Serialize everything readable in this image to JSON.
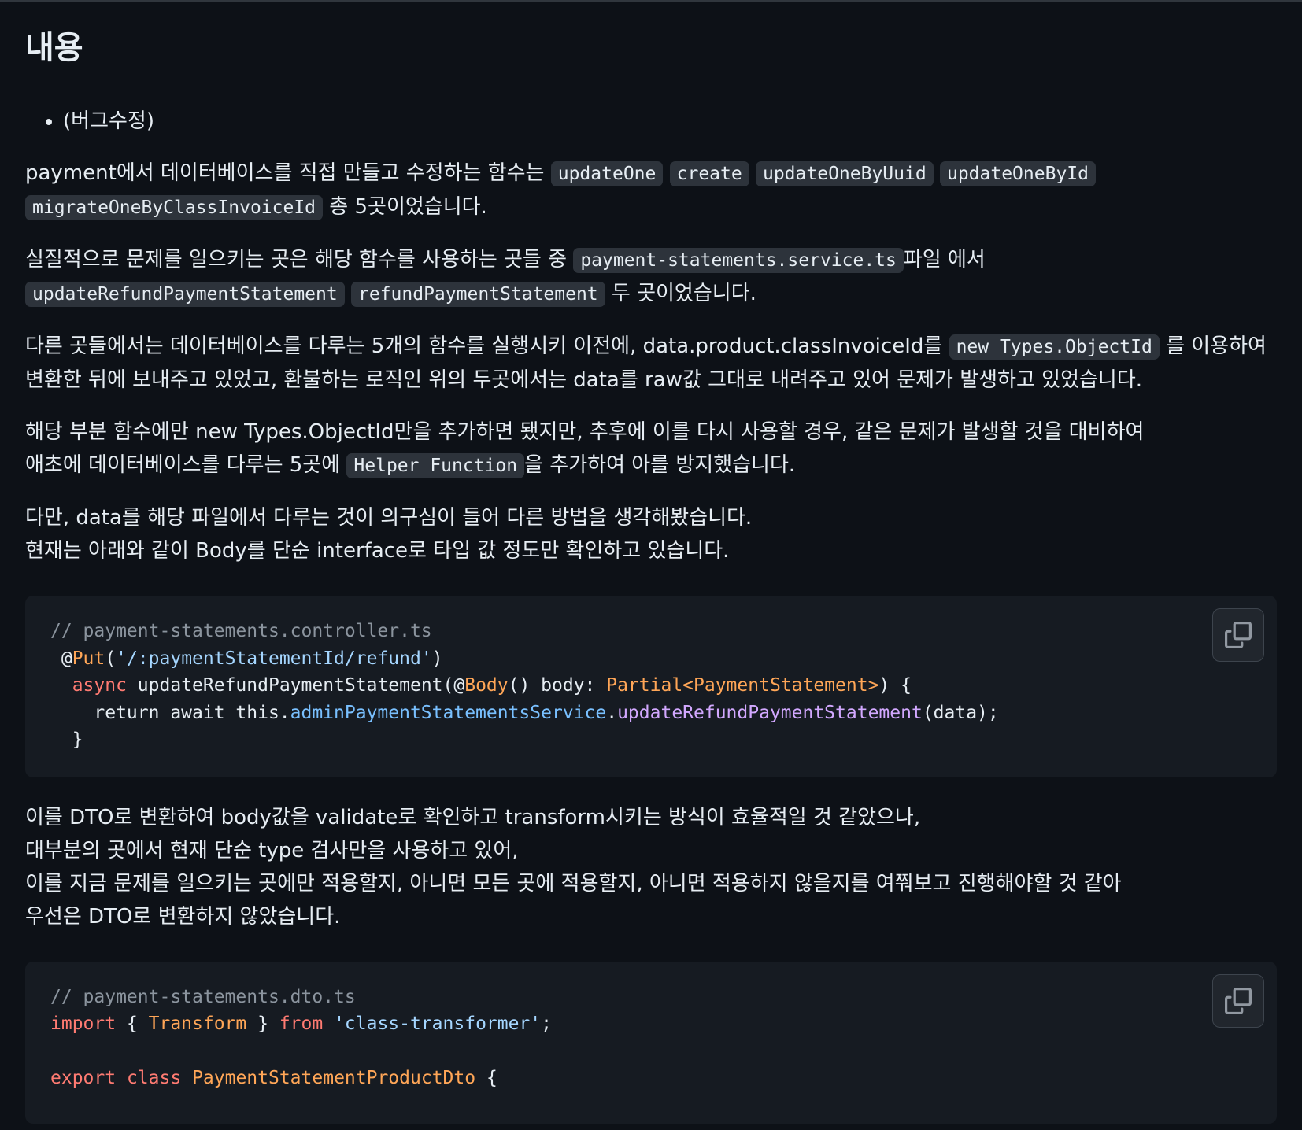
{
  "heading": "내용",
  "bullets": [
    "(버그수정)"
  ],
  "p1": {
    "t1": "payment에서 데이터베이스를 직접 만들고 수정하는 함수는 ",
    "codes": [
      "updateOne",
      "create",
      "updateOneByUuid",
      "updateOneById",
      "migrateOneByClassInvoiceId"
    ],
    "t2": " 총 5곳이었습니다."
  },
  "p2": {
    "t1": "실질적으로 문제를 일으키는 곳은 해당 함수를 사용하는 곳들 중 ",
    "c1": "payment-statements.service.ts",
    "t2": "파일 에서",
    "c2": "updateRefundPaymentStatement",
    "c3": "refundPaymentStatement",
    "t3": " 두 곳이었습니다."
  },
  "p3": {
    "t1": "다른 곳들에서는 데이터베이스를 다루는 5개의 함수를 실행시키 이전에, data.product.classInvoiceId를 ",
    "c1": "new Types.ObjectId",
    "t2": " 를 이용하여 변환한 뒤에 보내주고 있었고, 환불하는 로직인 위의 두곳에서는 data를 raw값 그대로 내려주고 있어 문제가 발생하고 있었습니다."
  },
  "p4": {
    "line1": "해당 부분 함수에만 new Types.ObjectId만을 추가하면 됐지만, 추후에 이를 다시 사용할 경우, 같은 문제가 발생할 것을 대비하여",
    "t1": "애초에 데이터베이스를 다루는 5곳에 ",
    "c1": "Helper Function",
    "t2": "을 추가하여 아를 방지했습니다."
  },
  "p5": {
    "line1": "다만, data를 해당 파일에서 다루는 것이 의구심이 들어 다른 방법을 생각해봤습니다.",
    "line2": "현재는 아래와 같이 Body를 단순 interface로 타입 값 정도만 확인하고 있습니다."
  },
  "code1": {
    "comment": "// payment-statements.controller.ts",
    "l2_pre": " @",
    "l2_deco": "Put",
    "l2_open": "(",
    "l2_str": "'/:paymentStatementId/refund'",
    "l2_close": ")",
    "l3_indent": "  ",
    "l3_kw": "async",
    "l3_mid": " updateRefundPaymentStatement(@",
    "l3_deco": "Body",
    "l3_mid2": "() body: ",
    "l3_type": "Partial<PaymentStatement>",
    "l3_end": ") {",
    "l4_pre": "    return await this.",
    "l4_prop": "adminPaymentStatementsService",
    "l4_dot": ".",
    "l4_fn": "updateRefundPaymentStatement",
    "l4_end": "(data);",
    "l5": "  }"
  },
  "p6": {
    "line1": "이를 DTO로 변환하여 body값을 validate로 확인하고 transform시키는 방식이 효율적일 것 같았으나,",
    "line2": "대부분의 곳에서 현재 단순 type 검사만을 사용하고 있어,",
    "line3": "이를 지금 문제를 일으키는 곳에만 적용할지, 아니면 모든 곳에 적용할지, 아니면 적용하지 않을지를 여쭤보고 진행해야할 것 같아",
    "line4": "우선은 DTO로 변환하지 않았습니다."
  },
  "code2": {
    "comment": "// payment-statements.dto.ts",
    "l2_kw1": "import",
    "l2_mid1": " { ",
    "l2_type": "Transform",
    "l2_mid2": " } ",
    "l2_kw2": "from",
    "l2_sp": " ",
    "l2_str": "'class-transformer'",
    "l2_end": ";",
    "l4_kw1": "export",
    "l4_sp1": " ",
    "l4_kw2": "class",
    "l4_sp2": " ",
    "l4_type": "PaymentStatementProductDto",
    "l4_end": " {"
  },
  "icons": {
    "copy": "copy-icon"
  },
  "colors": {
    "background": "#0d1117",
    "code_bg": "#161b22",
    "inline_code_bg": "#2d333b"
  }
}
